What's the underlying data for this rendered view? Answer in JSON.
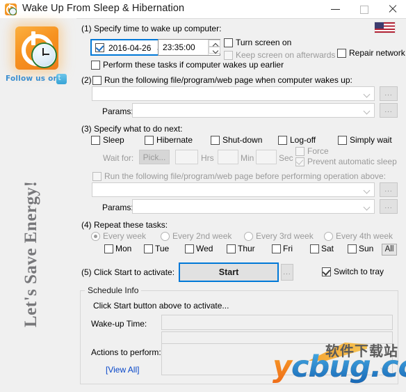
{
  "window": {
    "title": "Wake Up From Sleep & Hibernation",
    "icon": "app-clock-icon",
    "minimize": "minimize-icon",
    "maximize": "maximize-icon",
    "close": "close-icon"
  },
  "sidebar": {
    "logo": "app-logo",
    "follow_text": "Follow us on",
    "twitter_icon": "twitter-icon",
    "slogan": "Let's Save Energy!"
  },
  "language": {
    "flag": "us-flag-icon"
  },
  "step1": {
    "title": "(1) Specify time to wake up computer:",
    "date_enabled": true,
    "date_value": "2016-04-26",
    "time_value": "23:35:00",
    "turn_screen_on": "Turn screen on",
    "keep_screen_on": "Keep screen on afterwards",
    "repair_network": "Repair network",
    "perform_earlier": "Perform these tasks if computer wakes up earlier"
  },
  "step2": {
    "title": "(2)",
    "checkbox_label": "Run the following file/program/web page when computer wakes up:",
    "path_value": "",
    "params_label": "Params:",
    "params_value": "",
    "browse": "...",
    "browse2": "..."
  },
  "step3": {
    "title": "(3) Specify what to do next:",
    "options": [
      {
        "label": "Sleep",
        "checked": false
      },
      {
        "label": "Hibernate",
        "checked": false
      },
      {
        "label": "Shut-down",
        "checked": false
      },
      {
        "label": "Log-off",
        "checked": false
      },
      {
        "label": "Simply wait",
        "checked": false
      }
    ],
    "wait_for_label": "Wait for:",
    "pick_button": "Pick...",
    "hrs_value": "",
    "hrs_label": "Hrs",
    "min_value": "",
    "min_label": "Min",
    "sec_value": "",
    "sec_label": "Sec",
    "force_label": "Force",
    "prevent_label": "Prevent automatic sleep",
    "prevent_checked": true,
    "pre_run_label": "Run the following file/program/web page before performing operation above:",
    "pre_path_value": "",
    "pre_params_label": "Params:",
    "pre_params_value": "",
    "browse": "...",
    "browse2": "..."
  },
  "step4": {
    "title": "(4) Repeat these tasks:",
    "frequencies": [
      {
        "label": "Every week",
        "selected": true
      },
      {
        "label": "Every 2nd week",
        "selected": false
      },
      {
        "label": "Every 3rd week",
        "selected": false
      },
      {
        "label": "Every 4th week",
        "selected": false
      }
    ],
    "days": [
      {
        "label": "Mon",
        "checked": false
      },
      {
        "label": "Tue",
        "checked": false
      },
      {
        "label": "Wed",
        "checked": false
      },
      {
        "label": "Thur",
        "checked": false
      },
      {
        "label": "Fri",
        "checked": false
      },
      {
        "label": "Sat",
        "checked": false
      },
      {
        "label": "Sun",
        "checked": false
      }
    ],
    "all_button": "All"
  },
  "step5": {
    "title": "(5) Click Start to activate:",
    "start_button": "Start",
    "options_button": "...",
    "switch_to_tray": "Switch to tray",
    "switch_to_tray_checked": true
  },
  "schedule_info": {
    "group_title": "Schedule Info",
    "status": "Click Start button above to activate...",
    "wakeup_label": "Wake-up Time:",
    "wakeup_value": "",
    "extra_value": "",
    "actions_label": "Actions to perform:",
    "actions_value": "",
    "view_all": "[View All]"
  },
  "watermark": {
    "cn": "软件下载站",
    "brand_y": "y",
    "brand_c": "c",
    "brand_bug": "bug",
    "brand_tld": ".cc"
  }
}
